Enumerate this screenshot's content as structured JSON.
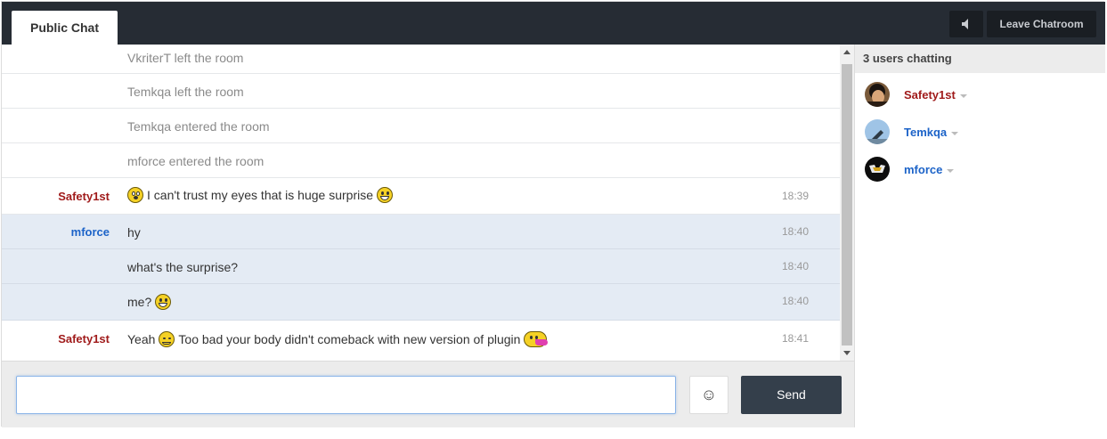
{
  "header": {
    "tab_label": "Public Chat",
    "sound_icon": "speaker-icon",
    "leave_label": "Leave Chatroom"
  },
  "messages": [
    {
      "user": "",
      "text": "VkriterT left the room",
      "time": "",
      "system": true
    },
    {
      "user": "",
      "text": "Temkqa left the room",
      "time": "",
      "system": true
    },
    {
      "user": "",
      "text": "Temkqa entered the room",
      "time": "",
      "system": true
    },
    {
      "user": "",
      "text": "mforce entered the room",
      "time": "",
      "system": true
    },
    {
      "user": "Safety1st",
      "text_before": "",
      "text": "I can't trust my eyes that is huge surprise",
      "time": "18:39"
    },
    {
      "user": "mforce",
      "text": "hy",
      "time": "18:40"
    },
    {
      "user": "",
      "text": "what's the surprise?",
      "time": "18:40"
    },
    {
      "user": "",
      "text": "me?",
      "time": "18:40"
    },
    {
      "user": "Safety1st",
      "text_before": "Yeah",
      "text": "Too bad your body didn't comeback with new version of plugin",
      "time": "18:41"
    }
  ],
  "composer": {
    "input_value": "",
    "input_placeholder": "",
    "emoji_icon": "smiley-icon",
    "send_label": "Send"
  },
  "sidebar": {
    "title": "3 users chatting",
    "users": [
      {
        "name": "Safety1st",
        "color": "#a01b1b"
      },
      {
        "name": "Temkqa",
        "color": "#1c63c8"
      },
      {
        "name": "mforce",
        "color": "#1c63c8"
      }
    ]
  },
  "colors": {
    "topbar": "#262c34",
    "user_red": "#a01b1b",
    "user_blue": "#1c63c8",
    "highlight_row": "#e4ebf4",
    "send_button": "#343f4b"
  }
}
